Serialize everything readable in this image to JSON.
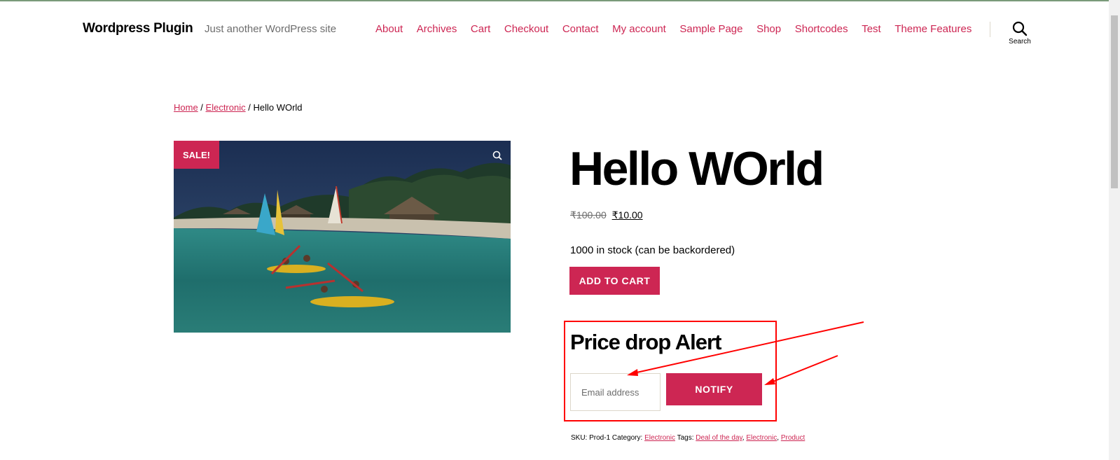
{
  "header": {
    "site_title": "Wordpress Plugin",
    "site_description": "Just another WordPress site",
    "nav": [
      "About",
      "Archives",
      "Cart",
      "Checkout",
      "Contact",
      "My account",
      "Sample Page",
      "Shop",
      "Shortcodes",
      "Test",
      "Theme Features"
    ],
    "search_label": "Search"
  },
  "breadcrumb": {
    "home": "Home",
    "sep1": " / ",
    "category": "Electronic",
    "sep2": " / ",
    "current": "Hello WOrld"
  },
  "product": {
    "sale_badge": "SALE!",
    "title": "Hello WOrld",
    "price_old": "₹100.00",
    "price_new": "₹10.00",
    "stock": "1000 in stock (can be backordered)",
    "add_to_cart": "ADD TO CART"
  },
  "price_alert": {
    "title": "Price drop Alert",
    "email_placeholder": "Email address",
    "notify_label": "NOTIFY"
  },
  "meta": {
    "sku_label": "SKU: ",
    "sku": "Prod-1",
    "category_label": " Category: ",
    "category": "Electronic",
    "tags_label": " Tags: ",
    "tags": [
      "Deal of the day",
      "Electronic",
      "Product"
    ],
    "tag_sep": ", "
  },
  "colors": {
    "accent": "#cd2653",
    "annotation": "#ff0000"
  },
  "icons": {
    "search": "search-icon",
    "zoom": "zoom-icon"
  }
}
